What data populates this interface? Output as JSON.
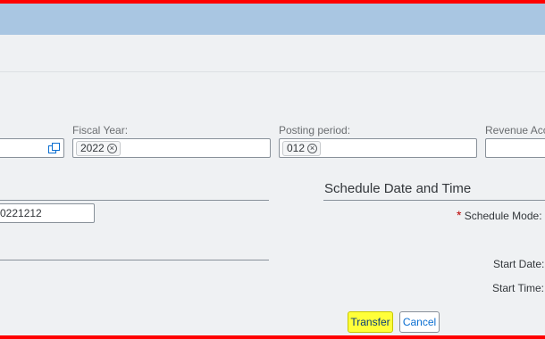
{
  "filters": {
    "fiscal_year": {
      "label": "Fiscal Year:",
      "token": "2022",
      "remove_icon": "remove-circle-icon"
    },
    "posting_period": {
      "label": "Posting period:",
      "token": "012",
      "remove_icon": "remove-circle-icon"
    },
    "revenue_account": {
      "label": "Revenue Acc"
    },
    "first_field": {
      "value_help_icon": "value-help-icon"
    }
  },
  "run_section": {
    "field_value": "0221212"
  },
  "schedule": {
    "title": "Schedule Date and Time",
    "required_marker": "*",
    "schedule_mode_label": "Schedule Mode:",
    "start_date_label": "Start Date:",
    "start_time_label": "Start Time:"
  },
  "footer": {
    "transfer_label": "Transfer",
    "cancel_label": "Cancel"
  },
  "colors": {
    "header_bar": "#a9c6e2",
    "highlight": "#ffff3a",
    "frame": "#ff0000"
  }
}
